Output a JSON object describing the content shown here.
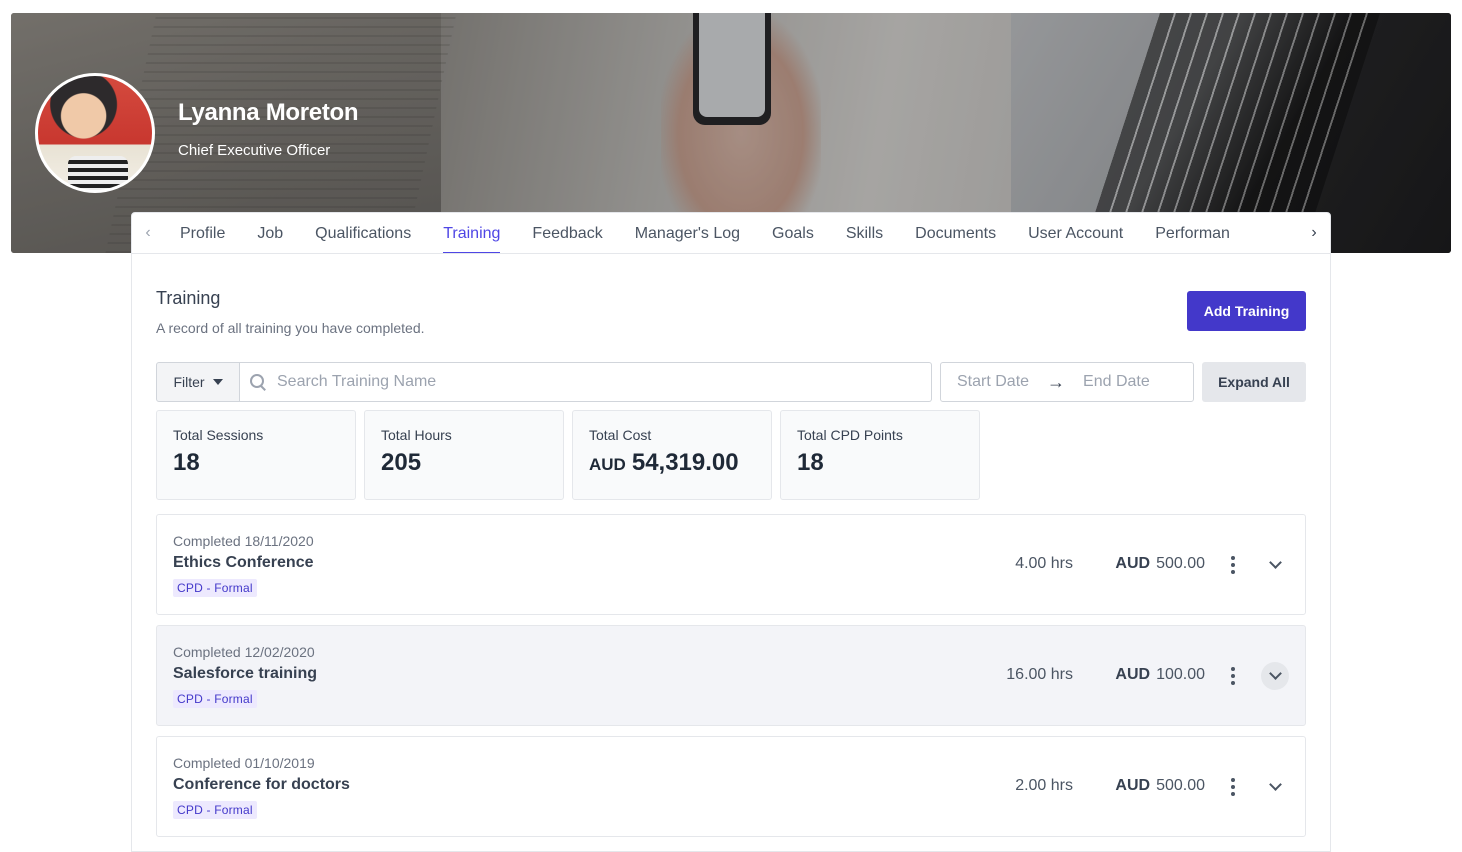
{
  "header": {
    "name": "Lyanna Moreton",
    "job_title": "Chief Executive Officer"
  },
  "tabs": [
    {
      "label": "Profile",
      "active": false
    },
    {
      "label": "Job",
      "active": false
    },
    {
      "label": "Qualifications",
      "active": false
    },
    {
      "label": "Training",
      "active": true
    },
    {
      "label": "Feedback",
      "active": false
    },
    {
      "label": "Manager's Log",
      "active": false
    },
    {
      "label": "Goals",
      "active": false
    },
    {
      "label": "Skills",
      "active": false
    },
    {
      "label": "Documents",
      "active": false
    },
    {
      "label": "User Account",
      "active": false
    },
    {
      "label": "Performan",
      "active": false
    }
  ],
  "section": {
    "title": "Training",
    "description": "A record of all training you have completed.",
    "add_button": "Add Training"
  },
  "toolbar": {
    "filter_label": "Filter",
    "search_placeholder": "Search Training Name",
    "start_date_placeholder": "Start Date",
    "end_date_placeholder": "End Date",
    "arrow": "→",
    "expand_all": "Expand All"
  },
  "stats": [
    {
      "label": "Total Sessions",
      "value": "18",
      "currency": ""
    },
    {
      "label": "Total Hours",
      "value": "205",
      "currency": ""
    },
    {
      "label": "Total Cost",
      "value": "54,319.00",
      "currency": "AUD"
    },
    {
      "label": "Total CPD Points",
      "value": "18",
      "currency": ""
    }
  ],
  "records": [
    {
      "completed": "Completed 18/11/2020",
      "name": "Ethics Conference",
      "tag": "CPD - Formal",
      "hours": "4.00 hrs",
      "currency": "AUD",
      "cost": "500.00"
    },
    {
      "completed": "Completed 12/02/2020",
      "name": "Salesforce training",
      "tag": "CPD - Formal",
      "hours": "16.00 hrs",
      "currency": "AUD",
      "cost": "100.00"
    },
    {
      "completed": "Completed 01/10/2019",
      "name": "Conference for doctors",
      "tag": "CPD - Formal",
      "hours": "2.00 hrs",
      "currency": "AUD",
      "cost": "500.00"
    }
  ],
  "colors": {
    "accent": "#4f46e5",
    "primary_button": "#4338ca",
    "tag_background": "#ede9fe"
  }
}
